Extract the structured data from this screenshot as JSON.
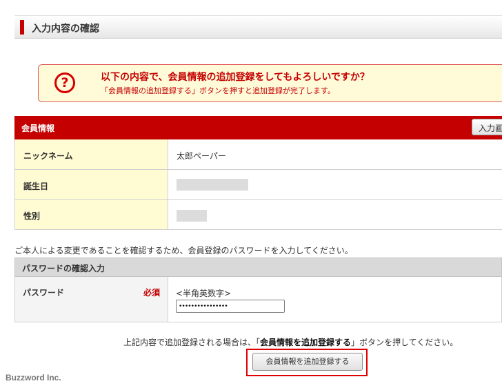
{
  "section": {
    "title": "入力内容の確認"
  },
  "notice": {
    "icon": "question-icon",
    "icon_glyph": "?",
    "main": "以下の内容で、会員情報の追加登録をしてもよろしいですか？",
    "sub": "「会員情報の追加登録する」ボタンを押すと追加登録が完了します。"
  },
  "member": {
    "header": "会員情報",
    "back_button": "入力画面へ戻る",
    "rows": [
      {
        "label": "ニックネーム",
        "value": "太郎ペーパー"
      },
      {
        "label": "誕生日",
        "value": ""
      },
      {
        "label": "性別",
        "value": ""
      }
    ]
  },
  "instruction": "ご本人による変更であることを確認するため、会員登録のパスワードを入力してください。",
  "password": {
    "header": "パスワードの確認入力",
    "label": "パスワード",
    "required": "必須",
    "hint": "<半角英数字>",
    "value": "••••••••••••••••"
  },
  "submit": {
    "note_prefix": "上記内容で追加登録される場合は、「",
    "note_bold": "会員情報を追加登録する",
    "note_suffix": "」ボタンを押してください。",
    "button": "会員情報を追加登録する"
  },
  "footer": "Buzzword Inc.",
  "colors": {
    "accent": "#c40000",
    "notice_bg": "#fffbd9",
    "row_header_bg": "#fffbd2"
  }
}
